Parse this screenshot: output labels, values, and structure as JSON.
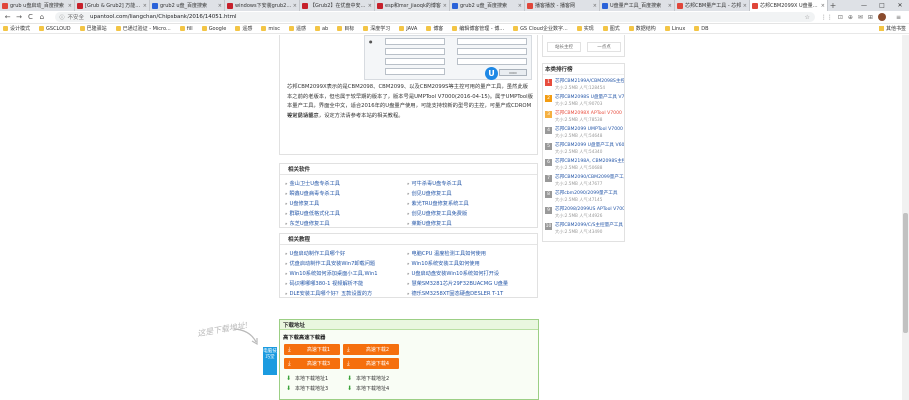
{
  "tabs": [
    {
      "title": "grub u盘启动_百度搜索",
      "color": "#e0463a"
    },
    {
      "title": "[Grub & Grub2] 万能引导",
      "color": "#c6202b"
    },
    {
      "title": "grub2 u盘_百度搜索",
      "color": "#2b63d9"
    },
    {
      "title": "windows下安装grub2_百",
      "color": "#c6202b"
    },
    {
      "title": "【Grub2】在优盘中安装G",
      "color": "#c6202b"
    },
    {
      "title": "esp和msr_jiaoqk的博客",
      "color": "#c6202b"
    },
    {
      "title": "grub2 u盘_百度搜索",
      "color": "#2b63d9"
    },
    {
      "title": "播客播放 - 播客网",
      "color": "#e0463a"
    },
    {
      "title": "U盘量产工具_百度搜索",
      "color": "#2b63d9"
    },
    {
      "title": "芯邦CBM量产工具 - 芯邦",
      "color": "#e0463a"
    },
    {
      "title": "芯邦CBM2099X U盘量产工",
      "color": "#e0463a"
    }
  ],
  "window_controls": [
    "—",
    "□",
    "✕"
  ],
  "toolbar": {
    "back": "←",
    "forward": "→",
    "reload": "C",
    "home": "⌂",
    "secure_label": "不安全",
    "url": "upantool.com/liangchan/Chipsbank/2016/14051.html",
    "star": "☆",
    "ext_icons": [
      "⋮⋮",
      "⊡",
      "⊕",
      "✉",
      "⊞",
      "≡"
    ]
  },
  "bookmarks": {
    "items": [
      "设计模式",
      "GSCLOUD",
      "巴隆驿站",
      "已通过验证 - Micro...",
      "fill",
      "Google",
      "遥感",
      "misc",
      "遥感",
      "ab",
      "目标",
      "深度学习",
      "JAVA",
      "博客",
      "编辑博客管理 - 博...",
      "GS Cloud企业数字...",
      "实现",
      "图式",
      "数据结构",
      "Linux",
      "DB"
    ],
    "right": "其他书签"
  },
  "article_image": {
    "btn1": "恢复出厂",
    "btn2": "一次出厂",
    "logo": "U"
  },
  "article": {
    "paragraph1": "芯邦CBM2099X表示的是CBM2098、CBM2099、以及CBM2099S等主控可用的量产工具，虽然此版本之前的老版本，但也属于较早期的版本了，版本号是UMPTool V7000(2016-04-15)。属于UMPTool版本量产工具，界面全中文，适合2016年的U盘量产使用，可能支持较新的型号的主控，可量产成CDROM等常见功能。",
    "paragraph2": "设定前请留意，设定方法请参考本站的相关教程。"
  },
  "related_software": {
    "title": "相关软件",
    "links": [
      "金山卫士U盘专杀工具",
      "可牛杀毒U盘专杀工具",
      "瞬鑫U盘病毒专杀工具",
      "创见U盘修复工具",
      "U盘修复工具",
      "紫光TRU盘修复系统工具",
      "群联U盘低格式化工具",
      "创见U盘修复工具免费版",
      "东芝U盘修复工具",
      "莱斯U盘修复工具"
    ]
  },
  "related_tutorials": {
    "title": "相关教程",
    "links": [
      "U盘启动制作工具哪个好",
      "电脑CPU 温度检测工具如何使用",
      "优盘启动制作工具安装Win7卸载问题",
      "Win10系统安装工具如何使用",
      "Win10系统如何添加桌面小工具,Win1",
      "U盘启动盘安装Win10系统如何打开设",
      "码识哪哪哪380-1 视频解析不能",
      "慧荣SM3281芯片29F32BUACMG U盘量",
      "DLE安装工具哪个好？五款设置的方",
      "德乐SM3258XT固态硬盘DESLER T-1T"
    ]
  },
  "download": {
    "header": "下载地址",
    "subheader": "高下载高速下载器",
    "buttons": [
      "高速下载1",
      "高速下载2",
      "高速下载3",
      "高速下载4"
    ],
    "local_links": [
      "本地下载地址1",
      "本地下载地址2",
      "本地下载地址3",
      "本地下载地址4"
    ],
    "stamp_text": "这是下载地址!",
    "side_badge": "电脑技巧堂"
  },
  "sidebar": {
    "top_buttons": [
      "站长主控",
      "一点点"
    ],
    "rank_title": "本类排行榜",
    "rank": [
      {
        "num": "1",
        "name": "芯邦CBM2199A/CBM2098S主控量产",
        "meta": "大小:2.5MB 人气:128454",
        "style": "hot1",
        "highlight": false
      },
      {
        "num": "2",
        "name": "芯邦CBM2098S U盘量产工具 V700",
        "meta": "大小:2.5MB 人气:90703",
        "style": "hot2",
        "highlight": false
      },
      {
        "num": "3",
        "name": "芯邦CBM2098X APTool V7000",
        "meta": "大小:2.5MB 人气:78538",
        "style": "hot3",
        "highlight": true
      },
      {
        "num": "4",
        "name": "芯邦CBM2099 UMPTool V7000 量产",
        "meta": "大小:2.5MB 人气:54648",
        "style": "",
        "highlight": false
      },
      {
        "num": "5",
        "name": "芯邦CBM2099 U盘量产工具 V6007",
        "meta": "大小:2.5MB 人气:54340",
        "style": "",
        "highlight": false
      },
      {
        "num": "6",
        "name": "芯邦CBM2198A, CBM2098S主控",
        "meta": "大小:2.5MB 人气:50688",
        "style": "",
        "highlight": false
      },
      {
        "num": "7",
        "name": "芯邦CBM2090/CBM2099量产工具",
        "meta": "大小:2.5MB 人气:47677",
        "style": "",
        "highlight": false
      },
      {
        "num": "8",
        "name": "芯邦cbm2090/2099量产工具",
        "meta": "大小:2.5MB 人气:47145",
        "style": "",
        "highlight": false
      },
      {
        "num": "9",
        "name": "芯邦2098/2099US APTool V700",
        "meta": "大小:2.5MB 人气:44926",
        "style": "",
        "highlight": false
      },
      {
        "num": "10",
        "name": "芯邦CBM2099/C/S主控量产工具",
        "meta": "大小:2.5MB 人气:43490",
        "style": "",
        "highlight": false
      }
    ]
  }
}
